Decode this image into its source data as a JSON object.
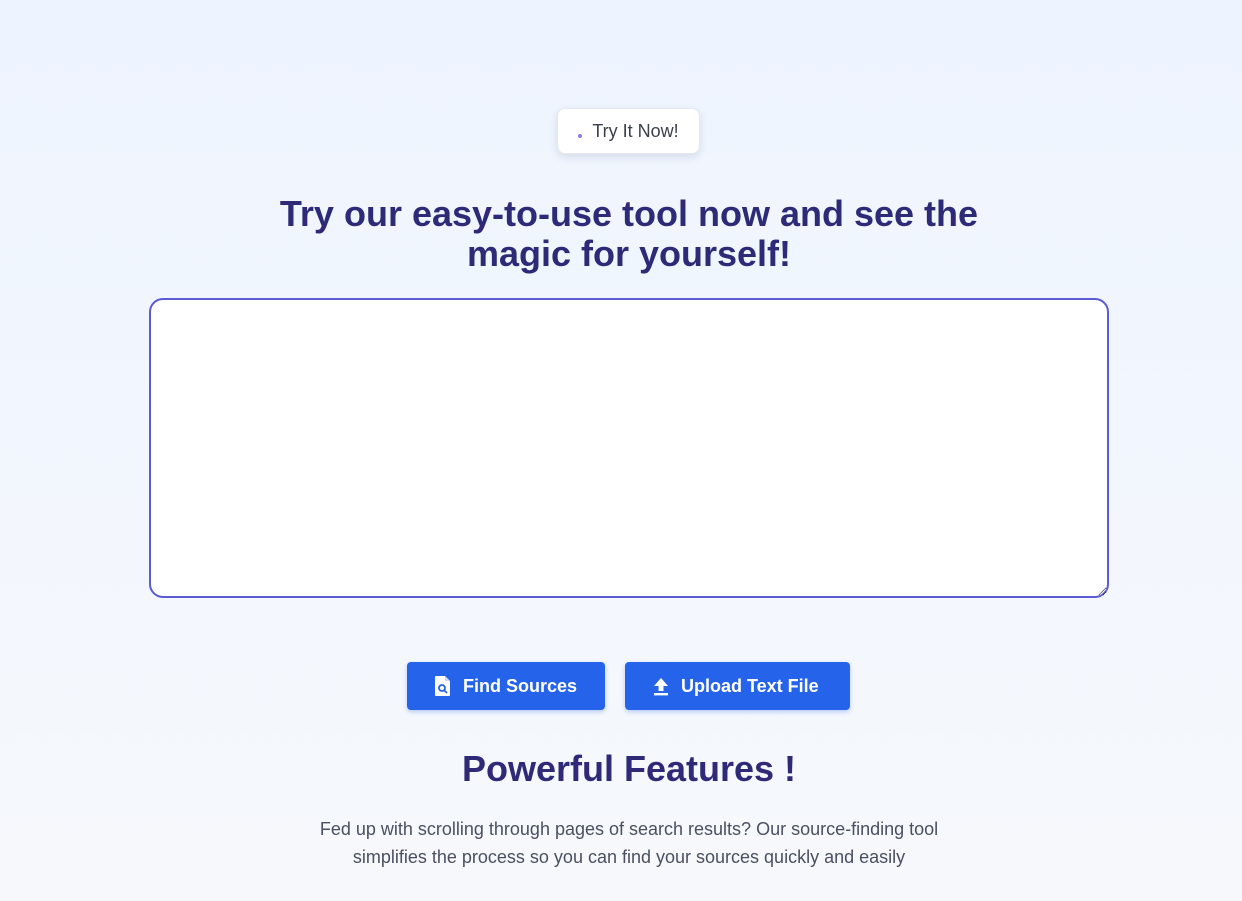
{
  "badge": {
    "label": "Try It Now!"
  },
  "hero": {
    "headline_line1": "Try our easy-to-use tool now and see the",
    "headline_line2": "magic for yourself!"
  },
  "editor": {
    "value": "",
    "placeholder": ""
  },
  "actions": {
    "find_label": "Find Sources",
    "find_icon": "file-search-icon",
    "upload_label": "Upload Text File",
    "upload_icon": "upload-icon"
  },
  "features": {
    "title": "Powerful Features !",
    "description_line1": "Fed up with scrolling through pages of search results? Our source-finding tool",
    "description_line2": "simplifies the process so you can find your sources quickly and easily"
  },
  "colors": {
    "accent": "#2563eb",
    "heading": "#2e2a78",
    "editor_border": "#5b5bd6"
  }
}
